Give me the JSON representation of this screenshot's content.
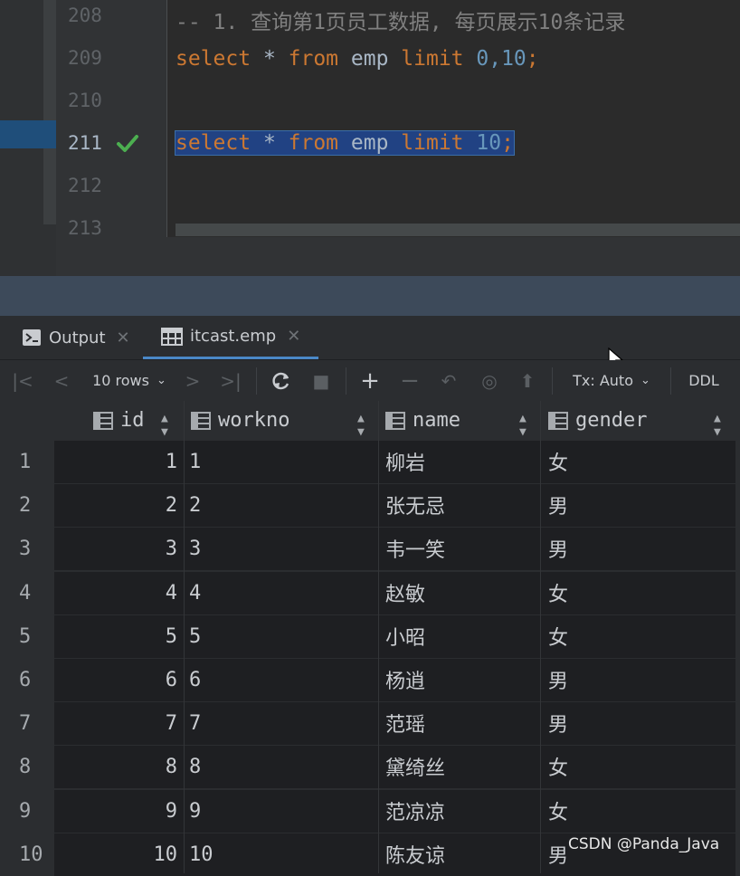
{
  "editor": {
    "lines": [
      {
        "number": "208",
        "kind": "comment",
        "text": "-- 1. 查询第1页员工数据, 每页展示10条记录"
      },
      {
        "number": "209",
        "kind": "sql",
        "parts": [
          "select",
          " * ",
          "from",
          " emp ",
          "limit",
          " ",
          "0,10",
          ";"
        ]
      },
      {
        "number": "210",
        "kind": "empty"
      },
      {
        "number": "211",
        "kind": "sql",
        "parts": [
          "select",
          " * ",
          "from",
          " emp ",
          "limit",
          " ",
          "10",
          ";"
        ]
      },
      {
        "number": "212",
        "kind": "empty"
      },
      {
        "number": "213",
        "kind": "empty"
      }
    ]
  },
  "tabs": [
    {
      "label": "Output",
      "icon": "console-icon"
    },
    {
      "label": "itcast.emp",
      "icon": "table-icon"
    }
  ],
  "toolbar": {
    "rows_label": "10 rows",
    "tx_label": "Tx: Auto",
    "ddl_label": "DDL"
  },
  "grid": {
    "columns": [
      "id",
      "workno",
      "name",
      "gender"
    ],
    "row_numbers": [
      "1",
      "2",
      "3",
      "4",
      "5",
      "6",
      "7",
      "8",
      "9",
      "10"
    ],
    "rows": [
      {
        "id": "1",
        "workno": "1",
        "name": "柳岩",
        "gender": "女"
      },
      {
        "id": "2",
        "workno": "2",
        "name": "张无忌",
        "gender": "男"
      },
      {
        "id": "3",
        "workno": "3",
        "name": "韦一笑",
        "gender": "男"
      },
      {
        "id": "4",
        "workno": "4",
        "name": "赵敏",
        "gender": "女"
      },
      {
        "id": "5",
        "workno": "5",
        "name": "小昭",
        "gender": "女"
      },
      {
        "id": "6",
        "workno": "6",
        "name": "杨逍",
        "gender": "男"
      },
      {
        "id": "7",
        "workno": "7",
        "name": "范瑶",
        "gender": "男"
      },
      {
        "id": "8",
        "workno": "8",
        "name": "黛绮丝",
        "gender": "女"
      },
      {
        "id": "9",
        "workno": "9",
        "name": "范凉凉",
        "gender": "女"
      },
      {
        "id": "10",
        "workno": "10",
        "name": "陈友谅",
        "gender": "男"
      }
    ]
  },
  "watermark": "CSDN @Panda_Java",
  "colors": {
    "keyword": "#cc7832",
    "number": "#6897bb",
    "comment": "#808080",
    "selection": "#214283",
    "check": "#4caf50"
  }
}
